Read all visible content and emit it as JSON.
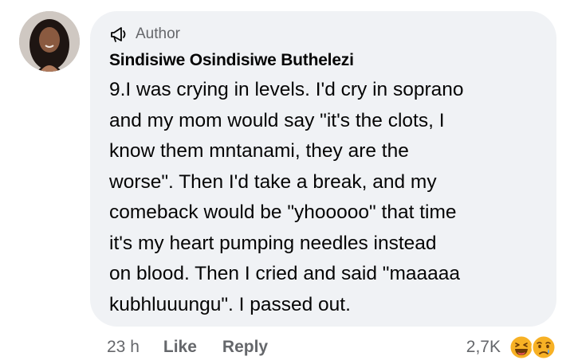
{
  "comment": {
    "author_badge": "Author",
    "author_name": "Sindisiwe Osindisiwe Buthelezi",
    "text_lines": [
      "9.I was crying in levels. I'd cry in soprano",
      "and my mom would say \"it's the clots, I",
      "know them mntanami, they are the",
      "worse\". Then I'd take a break, and my",
      "comeback would be \"yhooooo\" that time",
      "it's my heart pumping needles instead",
      "on blood. Then I cried and said \"maaaaa",
      "kubhluuungu\". I passed out."
    ]
  },
  "actions": {
    "timestamp": "23 h",
    "like_label": "Like",
    "reply_label": "Reply"
  },
  "reactions": {
    "count": "2,7K",
    "icons": [
      "laughing-emoji-icon",
      "sad-tear-emoji-icon"
    ]
  },
  "colors": {
    "bubble": "#f0f2f5",
    "secondary_text": "#65676b",
    "primary_text": "#050505",
    "emoji_yellow": "#f7b125"
  }
}
